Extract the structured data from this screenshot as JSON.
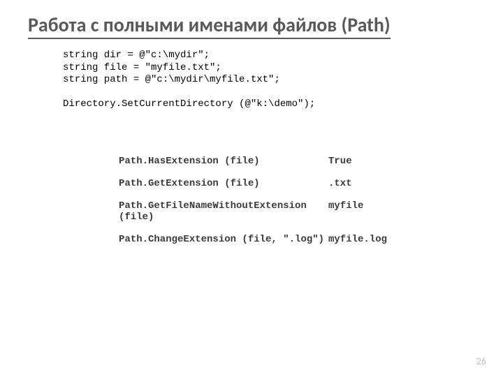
{
  "title_prefix": "Работа",
  "title_rest": " с полными именами файлов (Path)",
  "code": {
    "l1": "string dir = @\"c:\\mydir\";",
    "l2": "string file = \"myfile.txt\";",
    "l3": "string path = @\"c:\\mydir\\myfile.txt\";",
    "l4": "",
    "l5": "Directory.SetCurrentDirectory (@\"k:\\demo\");"
  },
  "rows": [
    {
      "call": "Path.HasExtension (file)",
      "result": "True"
    },
    {
      "call": "Path.GetExtension (file)",
      "result": ".txt"
    },
    {
      "call": "Path.GetFileNameWithoutExtension (file)",
      "result": "myfile"
    },
    {
      "call": "Path.ChangeExtension (file, \".log\")",
      "result": "myfile.log"
    }
  ],
  "page": "26"
}
